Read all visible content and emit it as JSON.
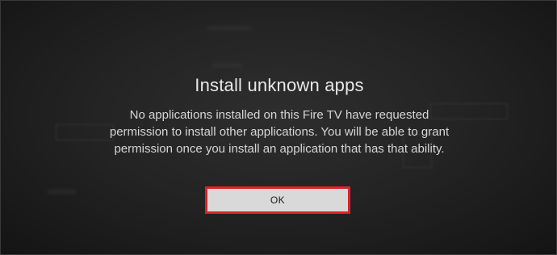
{
  "dialog": {
    "title": "Install unknown apps",
    "message": "No applications installed on this Fire TV have requested permission to install other applications. You will be able to grant permission once you install an application that has that ability.",
    "ok_label": "OK"
  },
  "colors": {
    "focus_outline": "#e0202a",
    "button_fill": "#d9d9d9",
    "background": "#242424"
  }
}
